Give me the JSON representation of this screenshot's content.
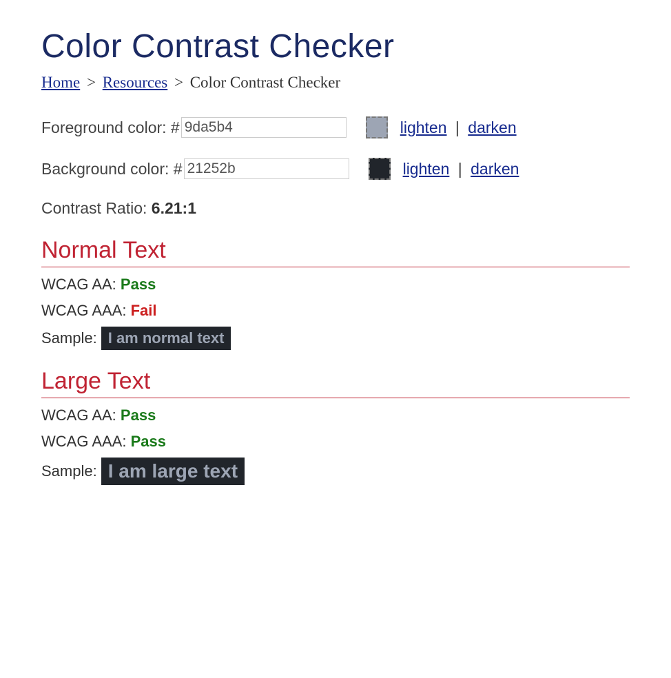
{
  "title": "Color Contrast Checker",
  "breadcrumb": {
    "home": "Home",
    "resources": "Resources",
    "current": "Color Contrast Checker",
    "sep": ">"
  },
  "foreground": {
    "label": "Foreground color: #",
    "value": "9da5b4",
    "hex": "#9da5b4",
    "lighten": "lighten",
    "darken": "darken"
  },
  "background": {
    "label": "Background color: #",
    "value": "21252b",
    "hex": "#21252b",
    "lighten": "lighten",
    "darken": "darken"
  },
  "ratio": {
    "label": "Contrast Ratio: ",
    "value": "6.21:1"
  },
  "normal": {
    "heading": "Normal Text",
    "aa_label": "WCAG AA: ",
    "aa_result": "Pass",
    "aa_status": "pass",
    "aaa_label": "WCAG AAA: ",
    "aaa_result": "Fail",
    "aaa_status": "fail",
    "sample_label": "Sample: ",
    "sample_text": "I am normal text"
  },
  "large": {
    "heading": "Large Text",
    "aa_label": "WCAG AA: ",
    "aa_result": "Pass",
    "aa_status": "pass",
    "aaa_label": "WCAG AAA: ",
    "aaa_result": "Pass",
    "aaa_status": "pass",
    "sample_label": "Sample: ",
    "sample_text": "I am large text"
  },
  "divider": "|"
}
